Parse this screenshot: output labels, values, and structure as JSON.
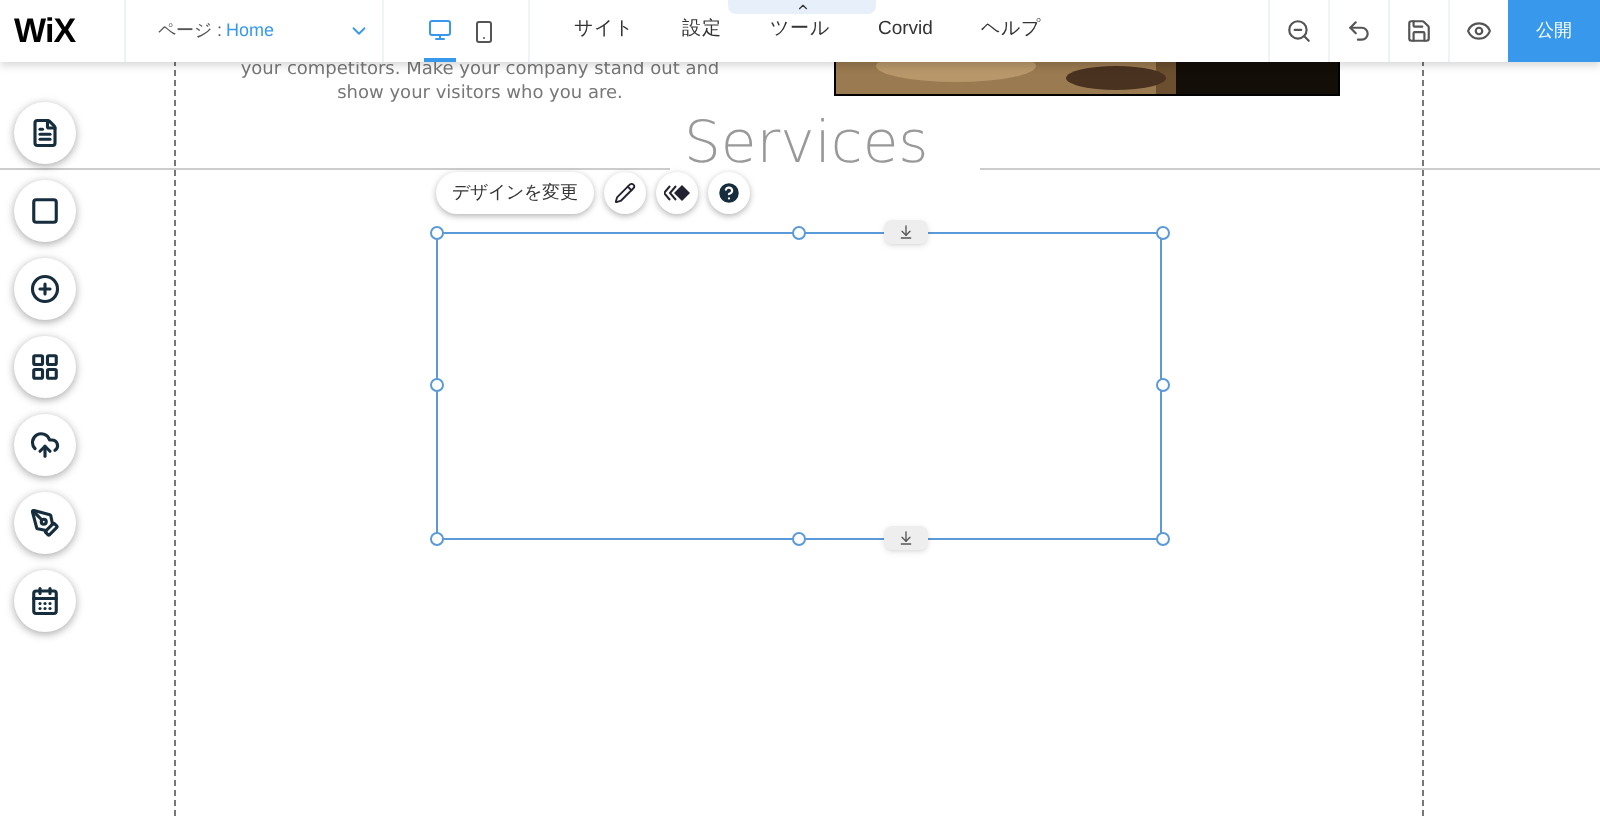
{
  "top_bar": {
    "logo": "WiX",
    "page_selector": {
      "label": "ページ :",
      "value": "Home"
    },
    "devices": [
      {
        "kind": "desktop",
        "selected": true
      },
      {
        "kind": "mobile",
        "selected": false
      }
    ],
    "menu": [
      "サイト",
      "設定",
      "ツール",
      "Corvid",
      "ヘルプ"
    ],
    "publish_button": "公開"
  },
  "canvas": {
    "paragraph_lines": [
      "your competitors. Make your company stand out and",
      "show your visitors who you are."
    ],
    "heading": "Services",
    "selection_toolbar": {
      "design_button": "デザインを変更"
    }
  }
}
